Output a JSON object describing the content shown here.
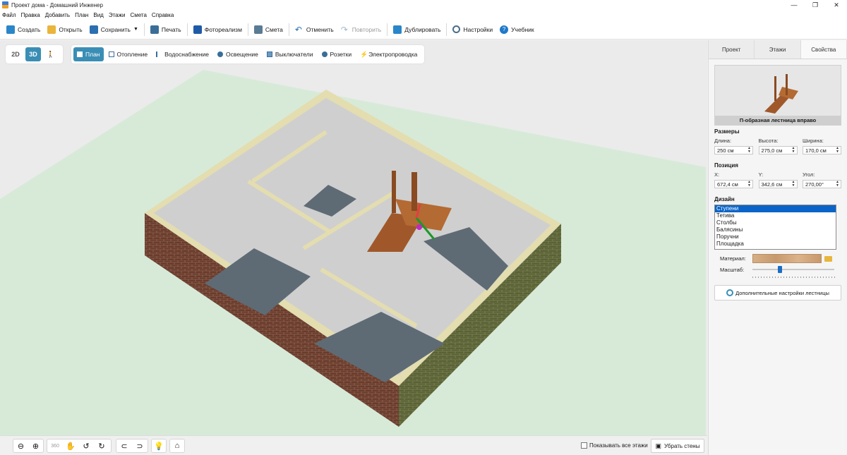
{
  "window": {
    "title": "Проект дома - Домашний Инженер",
    "controls": [
      "—",
      "❐",
      "✕"
    ]
  },
  "menu": [
    "Файл",
    "Правка",
    "Добавить",
    "План",
    "Вид",
    "Этажи",
    "Смета",
    "Справка"
  ],
  "toolbar": {
    "create": "Создать",
    "open": "Открыть",
    "save": "Сохранить",
    "print": "Печать",
    "photorealism": "Фотореализм",
    "estimate": "Смета",
    "undo": "Отменить",
    "redo": "Повторить",
    "duplicate": "Дублировать",
    "settings": "Настройки",
    "tutorial": "Учебник"
  },
  "view_modes": {
    "mode_2d": "2D",
    "mode_3d": "3D",
    "walk": "🚶",
    "active": "3D"
  },
  "layers": [
    {
      "label": "План",
      "icon": "plan-icon",
      "active": true
    },
    {
      "label": "Отопление",
      "icon": "heating-icon"
    },
    {
      "label": "Водоснабжение",
      "icon": "water-supply-icon"
    },
    {
      "label": "Освещение",
      "icon": "lighting-icon"
    },
    {
      "label": "Выключатели",
      "icon": "switches-icon"
    },
    {
      "label": "Розетки",
      "icon": "sockets-icon"
    },
    {
      "label": "Электропроводка",
      "icon": "wiring-icon"
    }
  ],
  "bottom": {
    "show_all_floors": "Показывать все этажи",
    "remove_walls": "Убрать стены",
    "icons": [
      "zoom-out-icon",
      "zoom-in-icon",
      "rotate-360-icon",
      "pan-hand-icon",
      "rotate-left-icon",
      "rotate-right-icon",
      "tilt-down-icon",
      "tilt-up-icon",
      "light-icon",
      "home-icon"
    ]
  },
  "panel": {
    "tabs": [
      "Проект",
      "Этажи",
      "Свойства"
    ],
    "active_tab": "Свойства",
    "preview_caption": "П-образная лестница вправо",
    "sizes": {
      "title": "Размеры",
      "length_label": "Длина:",
      "length": "250 см",
      "height_label": "Высота:",
      "height": "275,0 см",
      "width_label": "Ширина:",
      "width": "170,0 см"
    },
    "position": {
      "title": "Позиция",
      "x_label": "X:",
      "x": "672,4 см",
      "y_label": "Y:",
      "y": "342,6 см",
      "angle_label": "Угол:",
      "angle": "270,00°"
    },
    "design": {
      "title": "Дизайн",
      "items": [
        "Ступени",
        "Тетива",
        "Столбы",
        "Балясины",
        "Поручни",
        "Площадка"
      ],
      "selected": "Ступени",
      "material_label": "Материал:",
      "scale_label": "Масштаб:",
      "scale_value": 0.33
    },
    "advanced_button": "Дополнительные настройки лестницы"
  },
  "colors": {
    "accent": "#3a8eb5",
    "ground": "#d8ebd9",
    "brick": "#5b6332",
    "wall_top": "#ddd7a8",
    "floor": "#5e6b75"
  }
}
